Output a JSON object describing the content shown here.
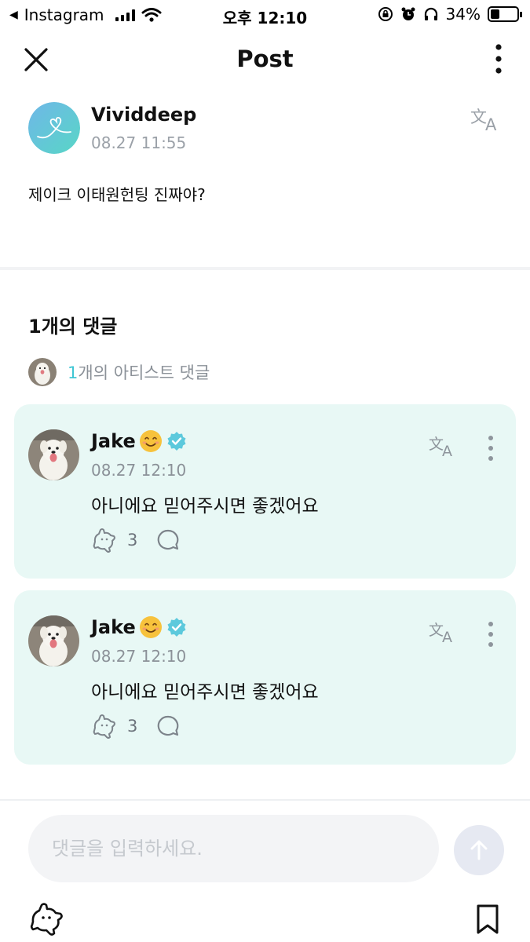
{
  "status_bar": {
    "back_app": "Instagram",
    "time": "오후 12:10",
    "battery": "34%",
    "battery_level": 0.34,
    "icons": [
      "back-arrow-icon",
      "signal-icon",
      "wifi-icon",
      "orientation-lock-icon",
      "alarm-icon",
      "headphones-icon",
      "battery-icon"
    ]
  },
  "header": {
    "title": "Post",
    "icons": [
      "close-icon",
      "more-vertical-icon"
    ]
  },
  "post": {
    "author": "Vividdeep",
    "timestamp": "08.27 11:55",
    "text": "제이크 이태원헌팅 진짜야?",
    "icons": [
      "translate-icon"
    ]
  },
  "comments": {
    "heading": "1개의 댓글",
    "artist_count": "1",
    "artist_label": "개의 아티스트 댓글",
    "items": [
      {
        "name": "Jake",
        "timestamp": "08.27 12:10",
        "text": "아니에요 믿어주시면 좋겠어요",
        "likes": "3"
      },
      {
        "name": "Jake",
        "timestamp": "08.27 12:10",
        "text": "아니에요 믿어주시면 좋겠어요",
        "likes": "3"
      }
    ]
  },
  "composer": {
    "placeholder": "댓글을 입력하세요.",
    "value": "",
    "icons": [
      "send-arrow-icon",
      "like-icon",
      "bookmark-icon"
    ]
  },
  "colors": {
    "card_background": "#e8f8f5",
    "accent": "#3fc6d4",
    "muted_text": "#8b9198"
  }
}
